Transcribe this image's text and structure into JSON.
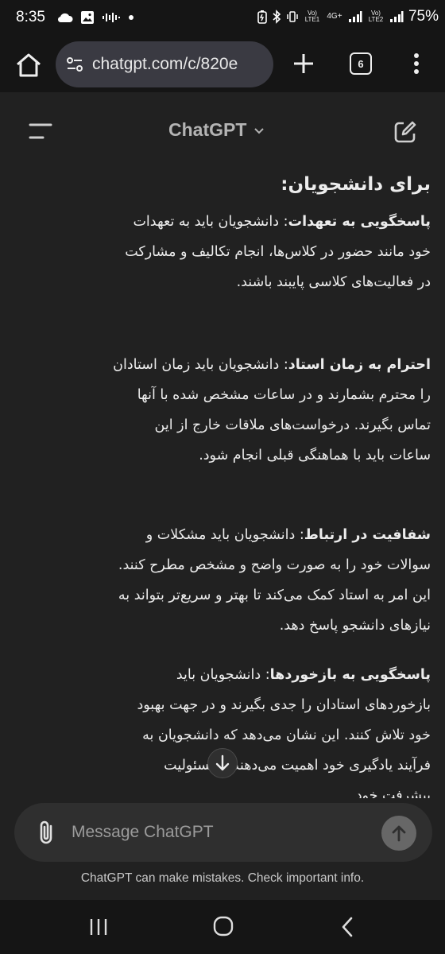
{
  "status_bar": {
    "time": "8:35",
    "lte1": "Vo) LTE1",
    "net": "4G+",
    "lte2": "Vo) LTE2",
    "battery": "75%"
  },
  "browser": {
    "url": "chatgpt.com/c/820e",
    "tab_count": "6"
  },
  "header": {
    "title": "ChatGPT"
  },
  "content": {
    "heading": "برای دانشجویان:",
    "paragraphs": [
      {
        "bold": "پاسخگویی به تعهدات",
        "text": ": دانشجویان باید به تعهدات خود مانند حضور در کلاس‌ها، انجام تکالیف و مشارکت در فعالیت‌های کلاسی پایبند باشند."
      },
      {
        "bold": "احترام به زمان استاد",
        "text": ": دانشجویان باید زمان استادان را محترم بشمارند و در ساعات مشخص شده با آنها تماس بگیرند. درخواست‌های ملاقات خارج از این ساعات باید با هماهنگی قبلی انجام شود."
      },
      {
        "bold": "شفافیت در ارتباط",
        "text": ": دانشجویان باید مشکلات و سوالات خود را به صورت واضح و مشخص مطرح کنند. این امر به استاد کمک می‌کند تا بهتر و سریع‌تر بتواند به نیازهای دانشجو پاسخ دهد."
      },
      {
        "bold": "پاسخگویی به بازخوردها",
        "text": ": دانشجویان باید بازخوردهای استادان را جدی بگیرند و در جهت بهبود خود تلاش کنند. این نشان می‌دهد که دانشجویان به فرآیند یادگیری خود اهمیت می‌دهند و مسئولیت پیشرفت خود"
      }
    ]
  },
  "composer": {
    "placeholder": "Message ChatGPT"
  },
  "disclaimer": "ChatGPT can make mistakes. Check important info.",
  "colors": {
    "background": "#212121",
    "composer": "#2f2f2f",
    "bars": "#151515"
  }
}
